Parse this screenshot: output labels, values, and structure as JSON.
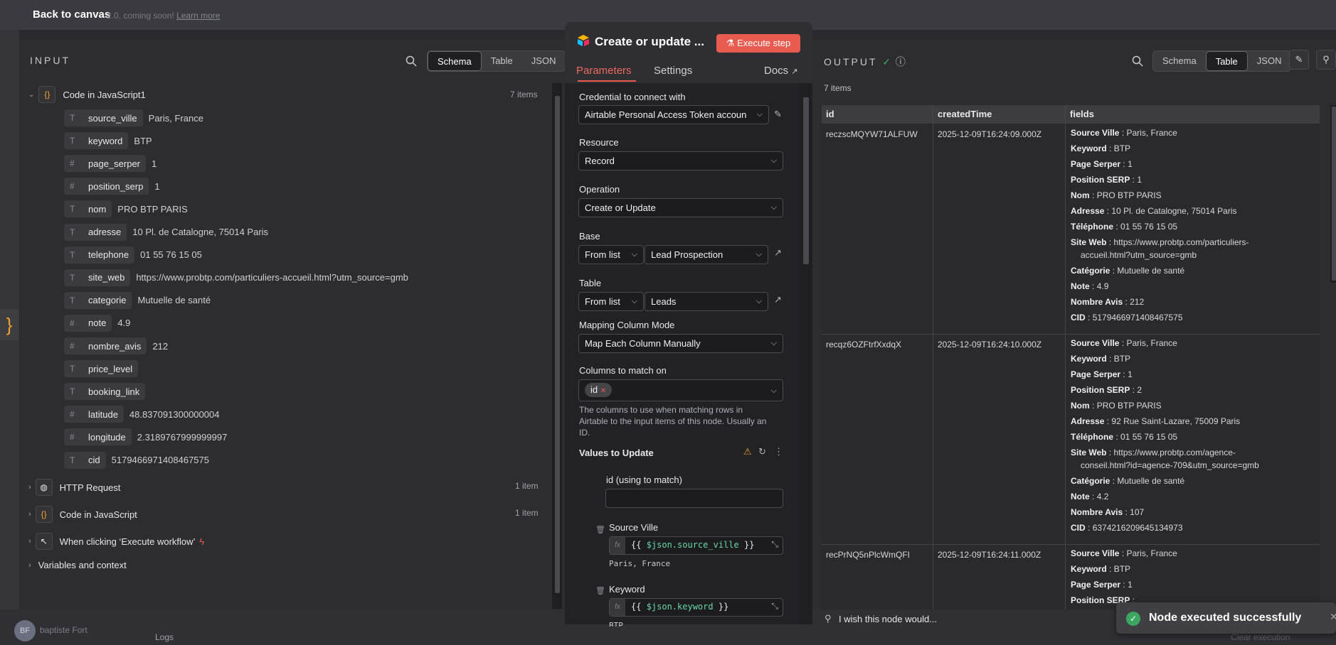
{
  "top": {
    "back": "Back to canvas",
    "banner": "2.0, coming soon!",
    "learn": "Learn more"
  },
  "input": {
    "title": "INPUT",
    "tabs": [
      "Schema",
      "Table",
      "JSON"
    ],
    "node": "Code in JavaScript1",
    "count": "7 items",
    "fields": [
      {
        "type": "T",
        "name": "source_ville",
        "value": "Paris, France"
      },
      {
        "type": "T",
        "name": "keyword",
        "value": "BTP"
      },
      {
        "type": "#",
        "name": "page_serper",
        "value": "1"
      },
      {
        "type": "#",
        "name": "position_serp",
        "value": "1"
      },
      {
        "type": "T",
        "name": "nom",
        "value": "PRO BTP PARIS"
      },
      {
        "type": "T",
        "name": "adresse",
        "value": "10 Pl. de Catalogne, 75014 Paris"
      },
      {
        "type": "T",
        "name": "telephone",
        "value": "01 55 76 15 05"
      },
      {
        "type": "T",
        "name": "site_web",
        "value": "https://www.probtp.com/particuliers-accueil.html?utm_source=gmb"
      },
      {
        "type": "T",
        "name": "categorie",
        "value": "Mutuelle de santé"
      },
      {
        "type": "#",
        "name": "note",
        "value": "4.9"
      },
      {
        "type": "#",
        "name": "nombre_avis",
        "value": "212"
      },
      {
        "type": "T",
        "name": "price_level",
        "value": ""
      },
      {
        "type": "T",
        "name": "booking_link",
        "value": ""
      },
      {
        "type": "#",
        "name": "latitude",
        "value": "48.837091300000004"
      },
      {
        "type": "#",
        "name": "longitude",
        "value": "2.3189767999999997"
      },
      {
        "type": "T",
        "name": "cid",
        "value": "5179466971408467575"
      }
    ],
    "nodes": [
      {
        "name": "HTTP Request",
        "count": "1 item",
        "icon": "globe-icon"
      },
      {
        "name": "Code in JavaScript",
        "count": "1 item",
        "icon": "braces-icon"
      },
      {
        "name": "When clicking ‘Execute workflow’",
        "count": "",
        "icon": "cursor-icon"
      }
    ],
    "vars": "Variables and context"
  },
  "mid": {
    "title": "Create or update ...",
    "exec": "Execute step",
    "tabs": {
      "params": "Parameters",
      "settings": "Settings",
      "docs": "Docs"
    },
    "cred_label": "Credential to connect with",
    "cred": "Airtable Personal Access Token accoun",
    "resource_label": "Resource",
    "resource": "Record",
    "operation_label": "Operation",
    "operation": "Create or Update",
    "base_label": "Base",
    "base_mode": "From list",
    "base": "Lead Prospection",
    "table_label": "Table",
    "table_mode": "From list",
    "table": "Leads",
    "mapping_label": "Mapping Column Mode",
    "mapping": "Map Each Column Manually",
    "match_label": "Columns to match on",
    "match_tag": "id",
    "hint1": "The columns to use when matching rows in",
    "hint2": "Airtable to the input items of this node. Usually an",
    "hint3": "ID.",
    "values_label": "Values to Update",
    "idmatch": "id (using to match)",
    "sv_label": "Source Ville",
    "sv_open": "{{",
    "sv_expr": "$json.source_ville",
    "sv_close": "}}",
    "sv_result": "Paris, France",
    "kw_label": "Keyword",
    "kw_open": "{{",
    "kw_expr": "$json.keyword",
    "kw_close": "}}",
    "kw_result": "BTP"
  },
  "output": {
    "title": "OUTPUT",
    "tabs": [
      "Schema",
      "Table",
      "JSON"
    ],
    "count": "7 items",
    "cols": [
      "id",
      "createdTime",
      "fields"
    ],
    "rows": [
      {
        "id": "reczscMQYW71ALFUW",
        "time": "2025-12-09T16:24:09.000Z",
        "fields": [
          [
            "Source Ville",
            "Paris, France"
          ],
          [
            "Keyword",
            "BTP"
          ],
          [
            "Page Serper",
            "1"
          ],
          [
            "Position SERP",
            "1"
          ],
          [
            "Nom",
            "PRO BTP PARIS"
          ],
          [
            "Adresse",
            "10 Pl. de Catalogne, 75014 Paris"
          ],
          [
            "Téléphone",
            "01 55 76 15 05"
          ],
          [
            "Site Web",
            "https://www.probtp.com/particuliers-"
          ],
          [
            "",
            "accueil.html?utm_source=gmb"
          ],
          [
            "Catégorie",
            "Mutuelle de santé"
          ],
          [
            "Note",
            "4.9"
          ],
          [
            "Nombre Avis",
            "212"
          ],
          [
            "CID",
            "5179466971408467575"
          ]
        ]
      },
      {
        "id": "recqz6OZFtrfXxdqX",
        "time": "2025-12-09T16:24:10.000Z",
        "fields": [
          [
            "Source Ville",
            "Paris, France"
          ],
          [
            "Keyword",
            "BTP"
          ],
          [
            "Page Serper",
            "1"
          ],
          [
            "Position SERP",
            "2"
          ],
          [
            "Nom",
            "PRO BTP PARIS"
          ],
          [
            "Adresse",
            "92 Rue Saint-Lazare, 75009 Paris"
          ],
          [
            "Téléphone",
            "01 55 76 15 05"
          ],
          [
            "Site Web",
            "https://www.probtp.com/agence-"
          ],
          [
            "",
            "conseil.html?id=agence-709&utm_source=gmb"
          ],
          [
            "Catégorie",
            "Mutuelle de santé"
          ],
          [
            "Note",
            "4.2"
          ],
          [
            "Nombre Avis",
            "107"
          ],
          [
            "CID",
            "6374216209645134973"
          ]
        ]
      },
      {
        "id": "recPrNQ5nPlcWmQFI",
        "time": "2025-12-09T16:24:11.000Z",
        "fields": [
          [
            "Source Ville",
            "Paris, France"
          ],
          [
            "Keyword",
            "BTP"
          ],
          [
            "Page Serper",
            "1"
          ],
          [
            "Position SERP",
            ""
          ]
        ]
      }
    ]
  },
  "feedback": "I wish this node would...",
  "toast": "Node executed successfully",
  "bottom": {
    "user": "baptiste Fort",
    "initials": "BF",
    "logs": "Logs",
    "clear": "Clear execution"
  }
}
